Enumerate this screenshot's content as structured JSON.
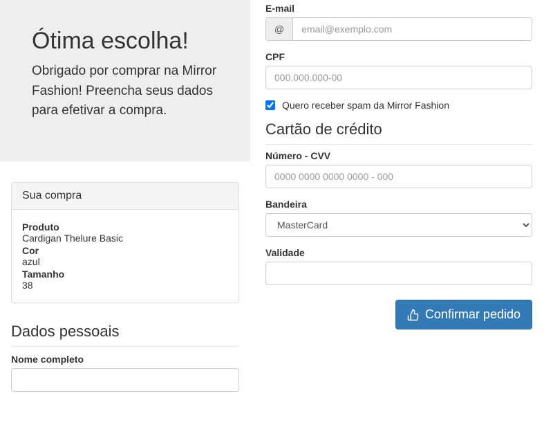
{
  "jumbotron": {
    "title": "Ótima escolha!",
    "subtitle": "Obrigado por comprar na Mirror Fashion! Preencha seus dados para efetivar a compra."
  },
  "panel": {
    "heading": "Sua compra",
    "product_label": "Produto",
    "product_value": "Cardigan Thelure Basic",
    "color_label": "Cor",
    "color_value": "azul",
    "size_label": "Tamanho",
    "size_value": "38"
  },
  "personal": {
    "heading": "Dados pessoais",
    "name_label": "Nome completo",
    "email_label": "E-mail",
    "email_addon": "@",
    "email_placeholder": "email@exemplo.com",
    "cpf_label": "CPF",
    "cpf_placeholder": "000.000.000-00",
    "spam_label": "Quero receber spam da Mirror Fashion"
  },
  "card": {
    "heading": "Cartão de crédito",
    "number_label": "Número - CVV",
    "number_placeholder": "0000 0000 0000 0000 - 000",
    "flag_label": "Bandeira",
    "flag_value": "MasterCard",
    "validity_label": "Validade"
  },
  "submit": {
    "label": "Confirmar pedido"
  }
}
